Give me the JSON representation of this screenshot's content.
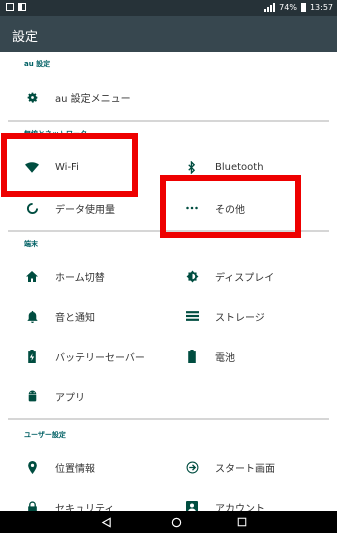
{
  "status": {
    "battery_text": "74%",
    "time": "13:57"
  },
  "app_bar": {
    "title": "設定"
  },
  "sections": {
    "au": {
      "header": "au 設定",
      "items": [
        {
          "label": "au 設定メニュー",
          "icon": "gear-icon"
        }
      ]
    },
    "wireless": {
      "header": "無線とネットワーク",
      "items": [
        {
          "label": "Wi-Fi",
          "icon": "wifi-icon"
        },
        {
          "label": "Bluetooth",
          "icon": "bluetooth-icon"
        },
        {
          "label": "データ使用量",
          "icon": "data-usage-icon"
        },
        {
          "label": "その他",
          "icon": "more-icon"
        }
      ]
    },
    "device": {
      "header": "端末",
      "items": [
        {
          "label": "ホーム切替",
          "icon": "home-icon"
        },
        {
          "label": "ディスプレイ",
          "icon": "brightness-icon"
        },
        {
          "label": "音と通知",
          "icon": "bell-icon"
        },
        {
          "label": "ストレージ",
          "icon": "storage-icon"
        },
        {
          "label": "バッテリーセーバー",
          "icon": "battery-saver-icon"
        },
        {
          "label": "電池",
          "icon": "battery-icon"
        },
        {
          "label": "アプリ",
          "icon": "android-icon"
        }
      ]
    },
    "personal": {
      "header": "ユーザー設定",
      "items": [
        {
          "label": "位置情報",
          "icon": "location-icon"
        },
        {
          "label": "スタート画面",
          "icon": "start-screen-icon"
        },
        {
          "label": "セキュリティ",
          "icon": "lock-icon"
        },
        {
          "label": "アカウント",
          "icon": "account-icon"
        }
      ]
    }
  },
  "colors": {
    "accent": "#006064",
    "icon": "#004d40",
    "highlight": "#ee0000",
    "app_bar": "#37474f",
    "status_bar": "#263238"
  }
}
